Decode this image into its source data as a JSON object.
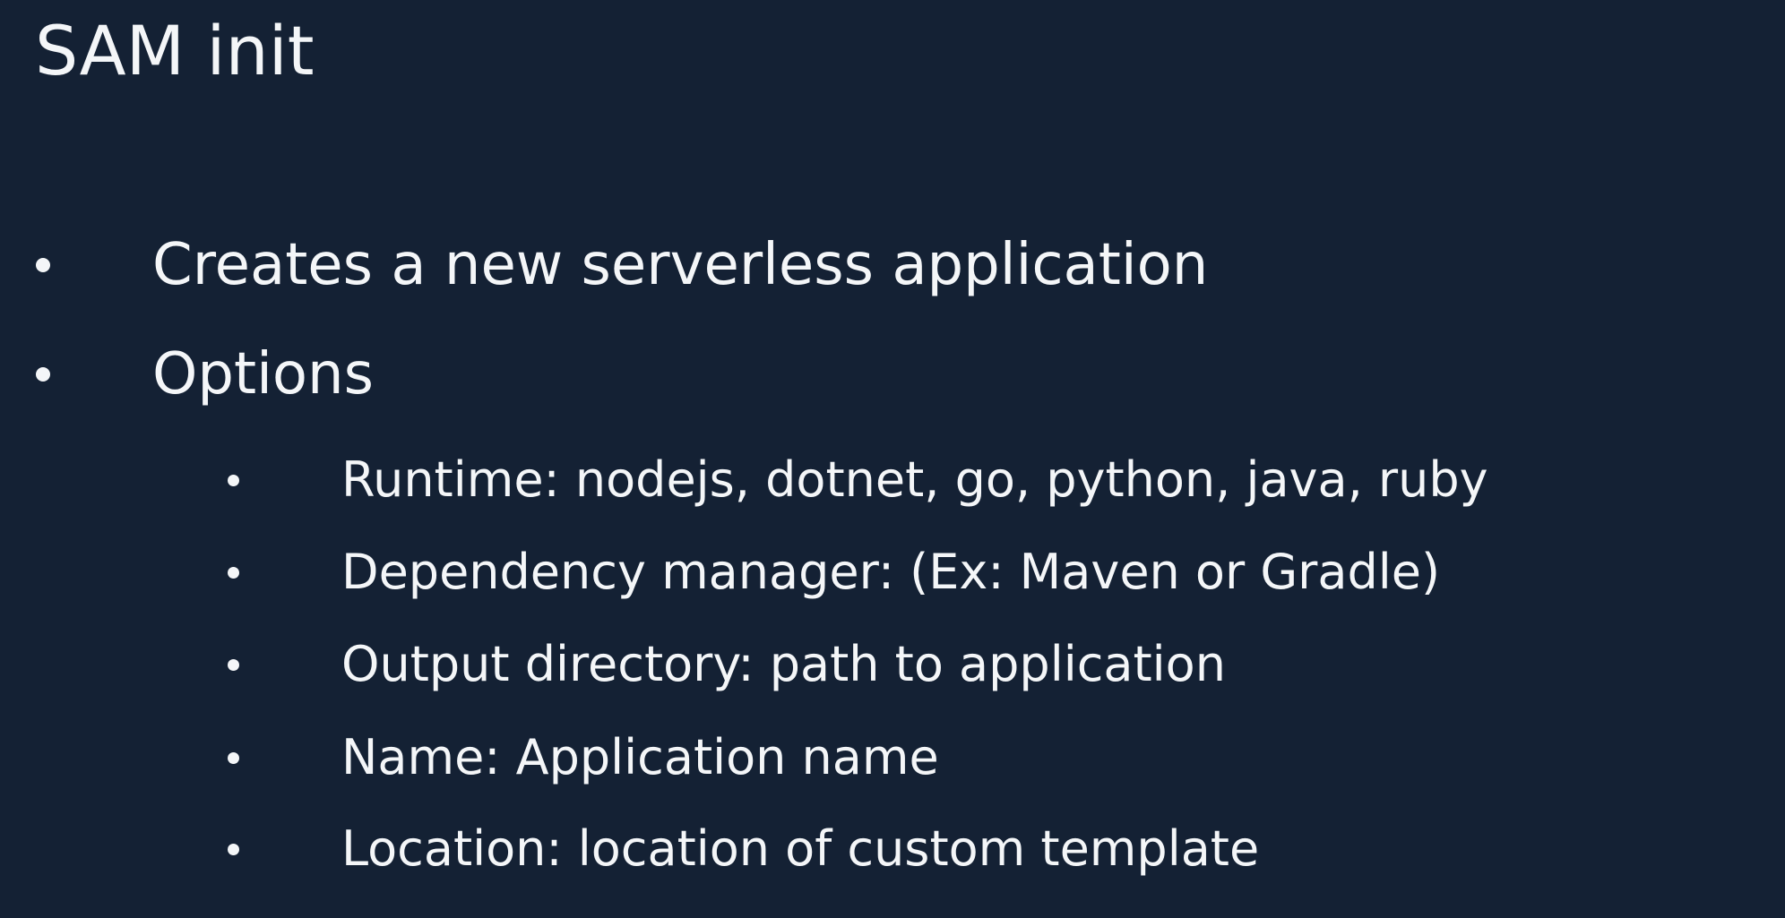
{
  "slide": {
    "title": "SAM init",
    "bullets": [
      {
        "text": "Creates a new serverless application"
      },
      {
        "text": "Options"
      }
    ],
    "sub_bullets": [
      {
        "text": "Runtime: nodejs, dotnet, go, python, java, ruby"
      },
      {
        "text": "Dependency manager: (Ex: Maven or Gradle)"
      },
      {
        "text": "Output directory: path to application"
      },
      {
        "text": "Name: Application name"
      },
      {
        "text": "Location: location of custom template"
      }
    ]
  }
}
